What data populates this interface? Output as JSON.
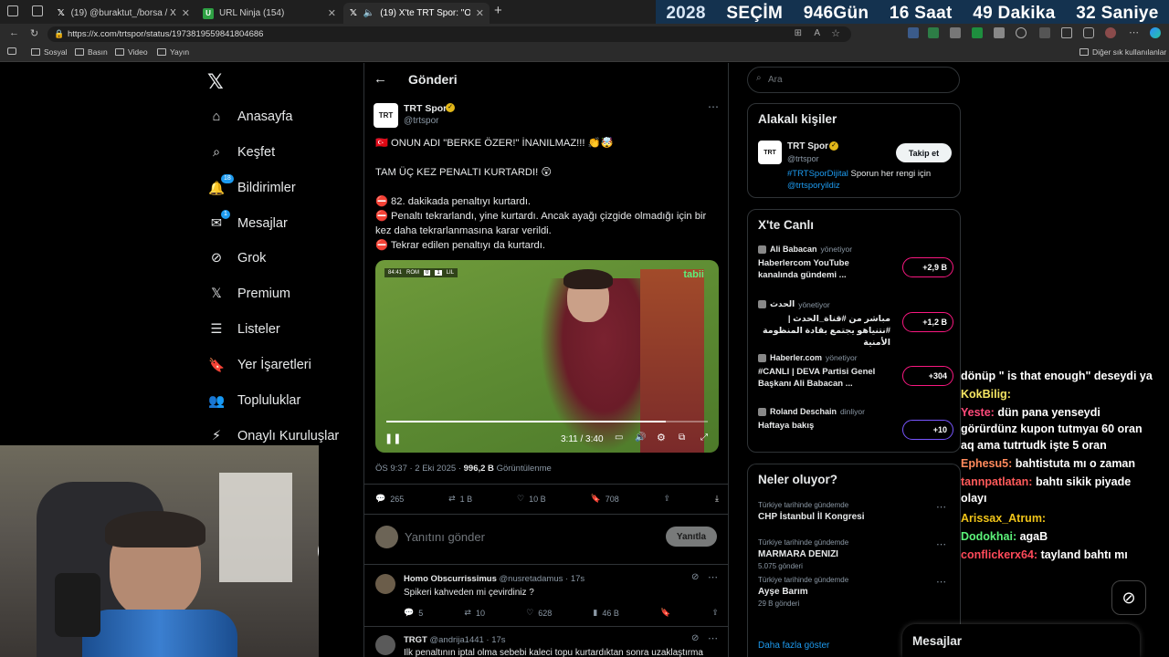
{
  "countdown": {
    "year": "2028",
    "label": "SEÇİM",
    "days": "946",
    "days_label": "Gün",
    "hours": "16",
    "hours_label": "Saat",
    "minutes": "49",
    "minutes_label": "Dakika",
    "seconds": "32",
    "seconds_label": "Saniye"
  },
  "tabs": [
    {
      "title": "(19) @buraktut_/borsa / X"
    },
    {
      "title": "URL Ninja (154)"
    },
    {
      "title": "(19) X'te TRT Spor: \"ONUN"
    }
  ],
  "url": "https://x.com/trtspor/status/1973819559841804686",
  "bookmarks": [
    "Sosyal",
    "Basın",
    "Video",
    "Yayın"
  ],
  "bookmarks_right": "Diğer sık kullanılanlar",
  "sidebar": {
    "items": [
      {
        "label": "Anasayfa",
        "icon": "home-icon"
      },
      {
        "label": "Keşfet",
        "icon": "search-icon"
      },
      {
        "label": "Bildirimler",
        "icon": "bell-icon",
        "badge": "18"
      },
      {
        "label": "Mesajlar",
        "icon": "mail-icon",
        "badge": "1"
      },
      {
        "label": "Grok",
        "icon": "grok-icon"
      },
      {
        "label": "Premium",
        "icon": "x-logo-icon"
      },
      {
        "label": "Listeler",
        "icon": "list-icon"
      },
      {
        "label": "Yer İşaretleri",
        "icon": "bookmark-icon"
      },
      {
        "label": "Topluluklar",
        "icon": "people-icon"
      },
      {
        "label": "Onaylı Kuruluşlar",
        "icon": "bolt-icon"
      }
    ]
  },
  "header": {
    "title": "Gönderi"
  },
  "tweet": {
    "author": "TRT Spor",
    "handle": "@trtspor",
    "avatar_text": "TRT",
    "line1": "ONUN ADI \"BERKE ÖZER!\" İNANILMAZ!!!",
    "line2": "TAM ÜÇ KEZ PENALTI KURTARDI!",
    "line3": "82. dakikada penaltıyı kurtardı.",
    "line4": "Penaltı tekrarlandı, yine kurtardı. Ancak ayağı çizgide olmadığı için bir kez daha tekrarlanmasına karar verildi.",
    "line5": "Tekrar edilen penaltıyı da kurtardı.",
    "video": {
      "time": "3:11 / 3:40",
      "progress": 0.87,
      "score_clock": "84:41",
      "team1": "ROM",
      "score1": "0",
      "score2": "1",
      "team2": "LIL",
      "channel": "tabii"
    },
    "meta_time": "ÖS 9:37 · 2 Eki 2025 ·",
    "views": "996,2 B",
    "views_label": "Görüntülenme",
    "replies": "265",
    "retweets": "1 B",
    "likes": "10 B",
    "bookmarks": "708"
  },
  "reply_box": {
    "placeholder": "Yanıtını gönder",
    "button": "Yanıtla"
  },
  "replies": [
    {
      "author": "Homo Obscurrissimus",
      "handle": "@nusretadamus · 17s",
      "text": "Spikeri kahveden mi çevirdiniz ?",
      "replies": "5",
      "retweets": "10",
      "likes": "628",
      "views": "46 B"
    },
    {
      "author": "TRGT",
      "handle": "@andrija1441 · 17s",
      "text": "İlk penaltının iptal olma sebebi kaleci topu kurtardıktan sonra uzaklaştırma"
    }
  ],
  "search": {
    "placeholder": "Ara"
  },
  "related": {
    "title": "Alakalı kişiler",
    "name": "TRT Spor",
    "handle": "@trtspor",
    "follow": "Takip et",
    "bio_link": "#TRTSporDijital",
    "bio_text": " Sporun her rengi için ",
    "bio_link2": "@trtsporyildiz"
  },
  "live": {
    "title": "X'te Canlı",
    "items": [
      {
        "host": "Ali Babacan",
        "role": "yönetiyor",
        "title": "Haberlercom YouTube kanalında gündemi ...",
        "count": "+2,9 B"
      },
      {
        "host": "الحدث",
        "role": "yönetiyor",
        "title": "مباشر من #قناة_الحدث | #نتنياهو يجتمع بقادة المنظومة الأمنية",
        "count": "+1,2 B"
      },
      {
        "host": "Haberler.com",
        "role": "yönetiyor",
        "title": "#CANLI | DEVA Partisi Genel Başkanı Ali Babacan ...",
        "count": "+304"
      },
      {
        "host": "Roland Deschain",
        "role": "dinliyor",
        "title": "Haftaya bakış",
        "count": "+10"
      }
    ]
  },
  "trends": {
    "title": "Neler oluyor?",
    "items": [
      {
        "sub": "Türkiye tarihinde gündemde",
        "title": "CHP İstanbul İl Kongresi",
        "count": ""
      },
      {
        "sub": "Türkiye tarihinde gündemde",
        "title": "MARMARA DENIZI",
        "count": "5.075 gönderi"
      },
      {
        "sub": "Türkiye tarihinde gündemde",
        "title": "Ayşe Barım",
        "count": "29 B gönderi"
      }
    ],
    "more": "Daha fazla göster"
  },
  "chat": [
    {
      "user": "",
      "text": "dönüp \" is that enough\" deseydi ya",
      "color": "#ffffff"
    },
    {
      "user": "KokBilig:",
      "text": "",
      "color": "#f5e663"
    },
    {
      "user": "Yeste:",
      "text": "dün pana yenseydi görürdünz kupon tutmyaı 60 oran aq ama tutrtudk işte 5 oran",
      "color": "#ff4a7b"
    },
    {
      "user": "Ephesu5:",
      "text": "bahtistuta mı o zaman",
      "color": "#ff8a5c"
    },
    {
      "user": "tannpatlatan:",
      "text": "bahtı sikik piyade olayı",
      "color": "#ff5a5a"
    },
    {
      "user": "Arissax_Atrum:",
      "text": "",
      "color": "#f0c419"
    },
    {
      "user": "Dodokhai:",
      "text": "agaB",
      "color": "#5cf27a"
    },
    {
      "user": "conflickerx64:",
      "text": "tayland bahtı mı",
      "color": "#ff4a5a"
    }
  ],
  "messages_bar": "Mesajlar"
}
